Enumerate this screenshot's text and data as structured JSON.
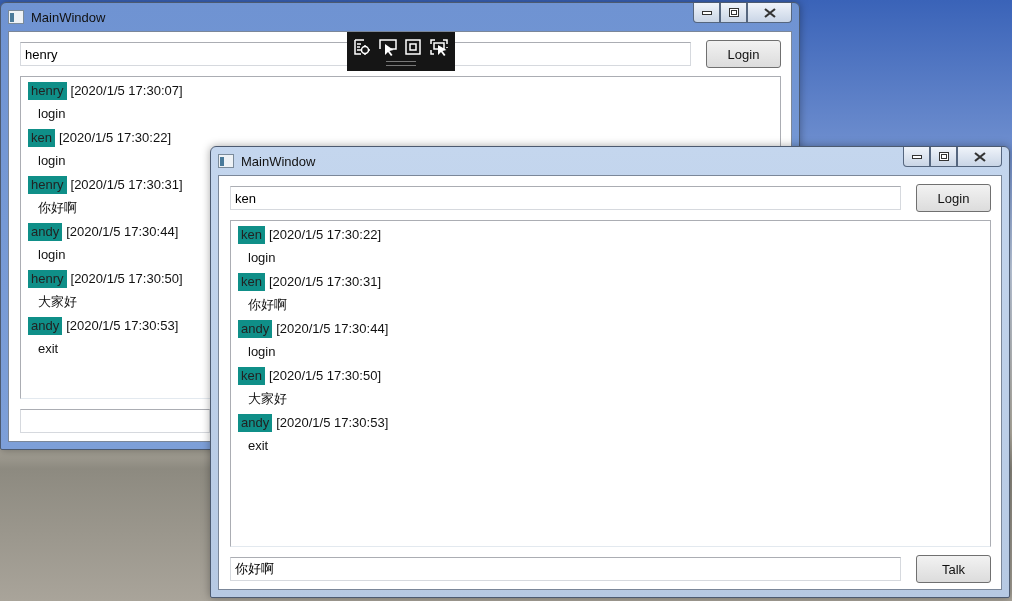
{
  "windows": [
    {
      "title": "MainWindow",
      "active": true,
      "user_field": {
        "value": "henry"
      },
      "login_button": "Login",
      "messages": [
        {
          "sender": "henry",
          "time": "[2020/1/5 17:30:07]",
          "text": "login"
        },
        {
          "sender": "ken",
          "time": "[2020/1/5 17:30:22]",
          "text": "login"
        },
        {
          "sender": "henry",
          "time": "[2020/1/5 17:30:31]",
          "text": "你好啊"
        },
        {
          "sender": "andy",
          "time": "[2020/1/5 17:30:44]",
          "text": "login"
        },
        {
          "sender": "henry",
          "time": "[2020/1/5 17:30:50]",
          "text": "大家好"
        },
        {
          "sender": "andy",
          "time": "[2020/1/5 17:30:53]",
          "text": "exit"
        }
      ]
    },
    {
      "title": "MainWindow",
      "active": false,
      "user_field": {
        "value": "ken"
      },
      "login_button": "Login",
      "messages": [
        {
          "sender": "ken",
          "time": "[2020/1/5 17:30:22]",
          "text": "login"
        },
        {
          "sender": "ken",
          "time": "[2020/1/5 17:30:31]",
          "text": "你好啊"
        },
        {
          "sender": "andy",
          "time": "[2020/1/5 17:30:44]",
          "text": "login"
        },
        {
          "sender": "ken",
          "time": "[2020/1/5 17:30:50]",
          "text": "大家好"
        },
        {
          "sender": "andy",
          "time": "[2020/1/5 17:30:53]",
          "text": "exit"
        }
      ],
      "message_field": {
        "value": "你好啊"
      },
      "talk_button": "Talk"
    }
  ]
}
